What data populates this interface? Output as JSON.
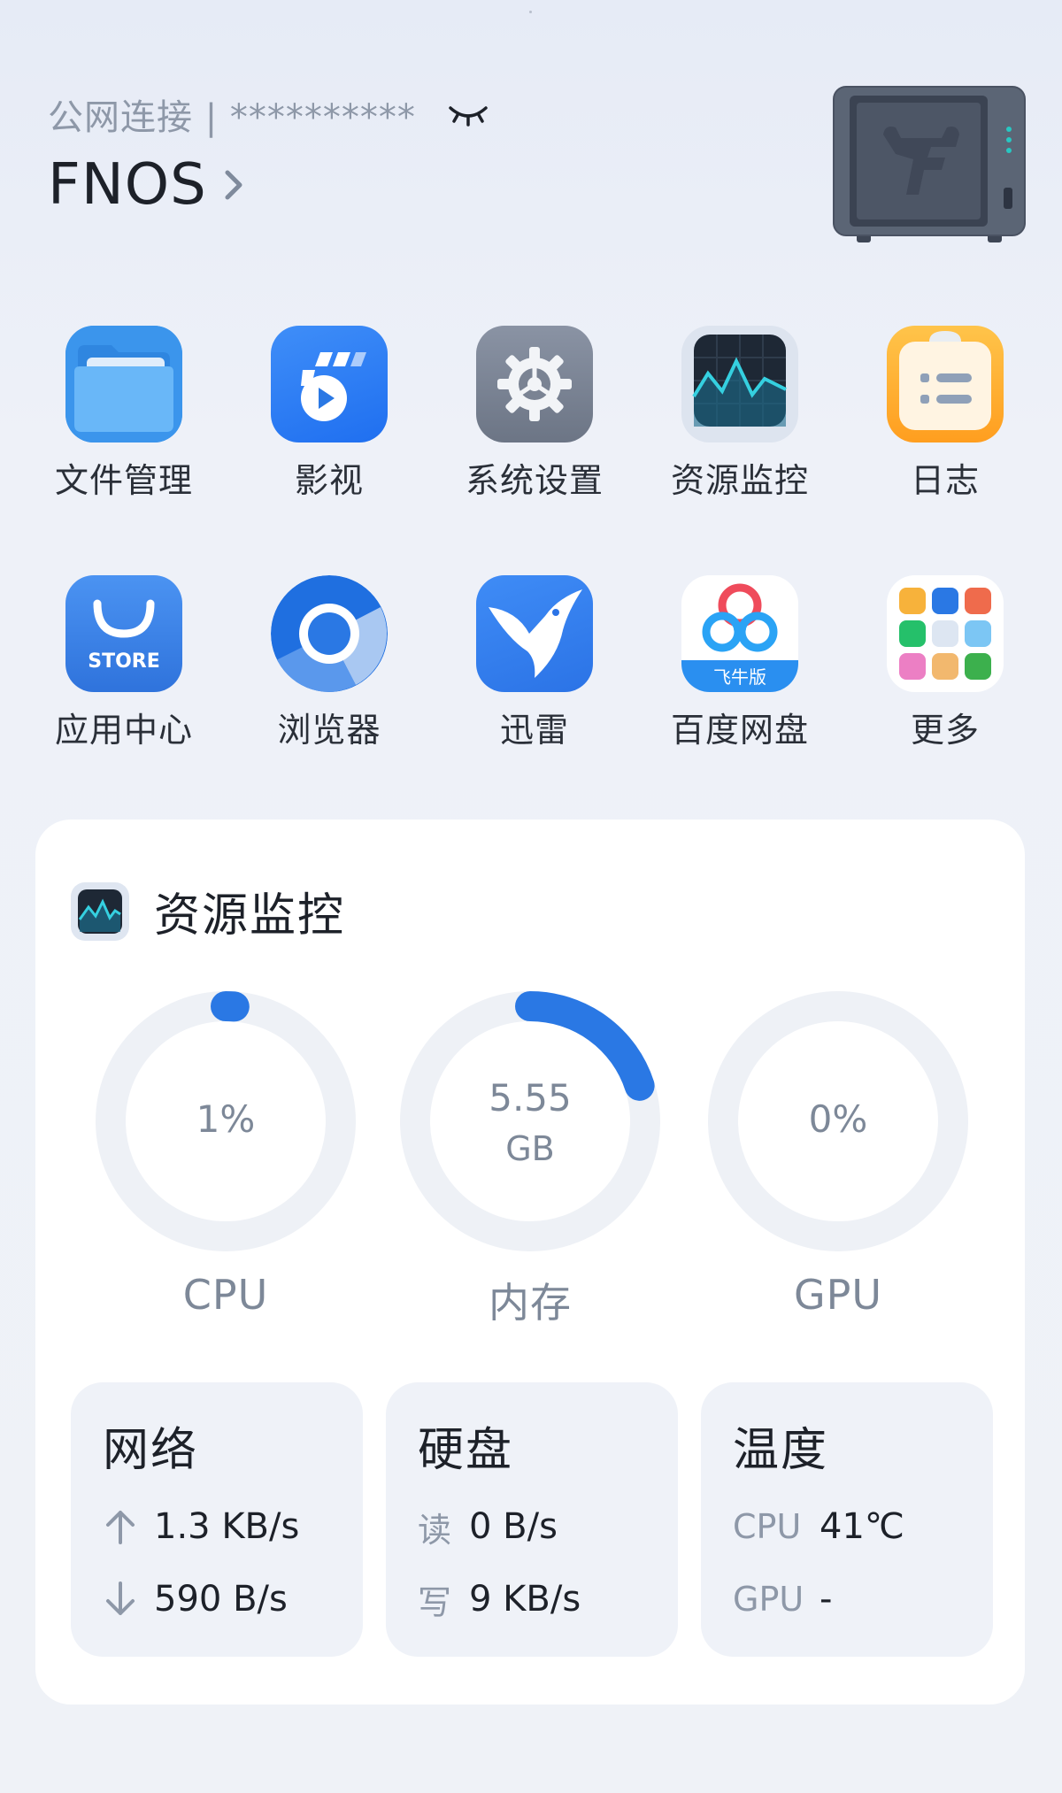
{
  "header": {
    "connection_text": "公网连接 | **********",
    "device_name": "FNOS",
    "eye_icon": "eye-closed-icon",
    "chevron_icon": "chevron-right-icon"
  },
  "apps": [
    {
      "label": "文件管理",
      "icon": "folder-icon"
    },
    {
      "label": "影视",
      "icon": "video-play-icon"
    },
    {
      "label": "系统设置",
      "icon": "gear-icon"
    },
    {
      "label": "资源监控",
      "icon": "activity-monitor-icon"
    },
    {
      "label": "日志",
      "icon": "notepad-icon"
    },
    {
      "label": "应用中心",
      "icon": "store-bag-icon",
      "icon_text": "STORE"
    },
    {
      "label": "浏览器",
      "icon": "chrome-browser-icon"
    },
    {
      "label": "迅雷",
      "icon": "thunder-bird-icon"
    },
    {
      "label": "百度网盘",
      "icon": "baidu-cloud-icon",
      "icon_text": "飞牛版"
    },
    {
      "label": "更多",
      "icon": "app-grid-icon"
    }
  ],
  "monitor": {
    "title": "资源监控",
    "gauges": [
      {
        "label": "CPU",
        "value": "1%",
        "fraction": 0.01
      },
      {
        "label": "内存",
        "value_line1": "5.55",
        "value_line2": "GB",
        "fraction": 0.2
      },
      {
        "label": "GPU",
        "value": "0%",
        "fraction": 0
      }
    ],
    "network": {
      "title": "网络",
      "up": "1.3 KB/s",
      "down": "590 B/s"
    },
    "disk": {
      "title": "硬盘",
      "read_label": "读",
      "read": "0 B/s",
      "write_label": "写",
      "write": "9 KB/s"
    },
    "temperature": {
      "title": "温度",
      "cpu_label": "CPU",
      "cpu": "41℃",
      "gpu_label": "GPU",
      "gpu": "-"
    }
  },
  "colors": {
    "accent": "#2a78e4",
    "gauge_track": "#eef1f6",
    "muted_text": "#8e98a8"
  }
}
